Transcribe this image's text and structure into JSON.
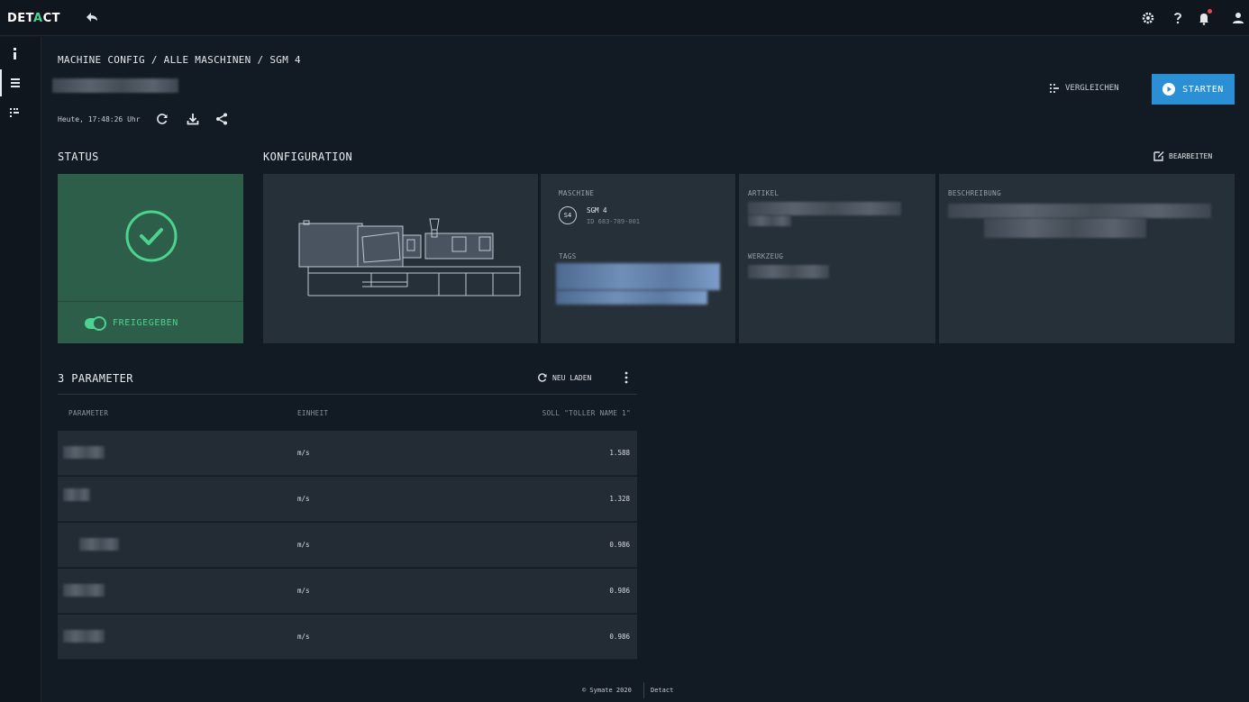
{
  "header": {
    "logo_prefix": "DET",
    "logo_accent": "A",
    "logo_suffix": "CT",
    "icons": [
      "back-icon",
      "gear-icon",
      "help-icon",
      "bell-icon",
      "user-icon"
    ]
  },
  "sidebar": {
    "items": [
      {
        "name": "info",
        "icon": "info-icon",
        "active": false
      },
      {
        "name": "table",
        "icon": "table-icon",
        "active": true
      },
      {
        "name": "compare",
        "icon": "compare-icon",
        "active": false
      }
    ]
  },
  "breadcrumb": {
    "text": "MACHINE CONFIG / ALLE MASCHINEN / SGM 4"
  },
  "actions": {
    "compare_label": "VERGLEICHEN",
    "start_label": "STARTEN"
  },
  "toolbar": {
    "timestamp": "Heute, 17:48:26 Uhr"
  },
  "status": {
    "section_title": "STATUS",
    "toggle_label": "FREIGEGEBEN",
    "toggle_on": true
  },
  "config": {
    "section_title": "KONFIGURATION",
    "edit_label": "BEARBEITEN",
    "machine_label": "MASCHINE",
    "machine_badge": "S4",
    "machine_name": "SGM 4",
    "machine_id": "ID 683-789-001",
    "tags_label": "TAGS",
    "artikel_label": "ARTIKEL",
    "werkzeug_label": "WERKZEUG",
    "beschreibung_label": "BESCHREIBUNG"
  },
  "parameters": {
    "title": "3 PARAMETER",
    "reload_label": "NEU LADEN",
    "columns": {
      "parameter": "PARAMETER",
      "einheit": "EINHEIT",
      "soll": "SOLL \"TOLLER NAME 1\""
    },
    "rows": [
      {
        "unit": "m/s",
        "value": "1.588"
      },
      {
        "unit": "m/s",
        "value": "1.328"
      },
      {
        "unit": "m/s",
        "value": "0.986"
      },
      {
        "unit": "m/s",
        "value": "0.986"
      },
      {
        "unit": "m/s",
        "value": "0.986"
      }
    ]
  },
  "footer": {
    "copyright": "© Symate 2020",
    "product": "Detact"
  },
  "colors": {
    "accent_green": "#4cd38f",
    "start_blue": "#2b8fd6",
    "status_card": "#2d5e49",
    "card_bg": "#263039",
    "page_bg": "#121a23"
  }
}
